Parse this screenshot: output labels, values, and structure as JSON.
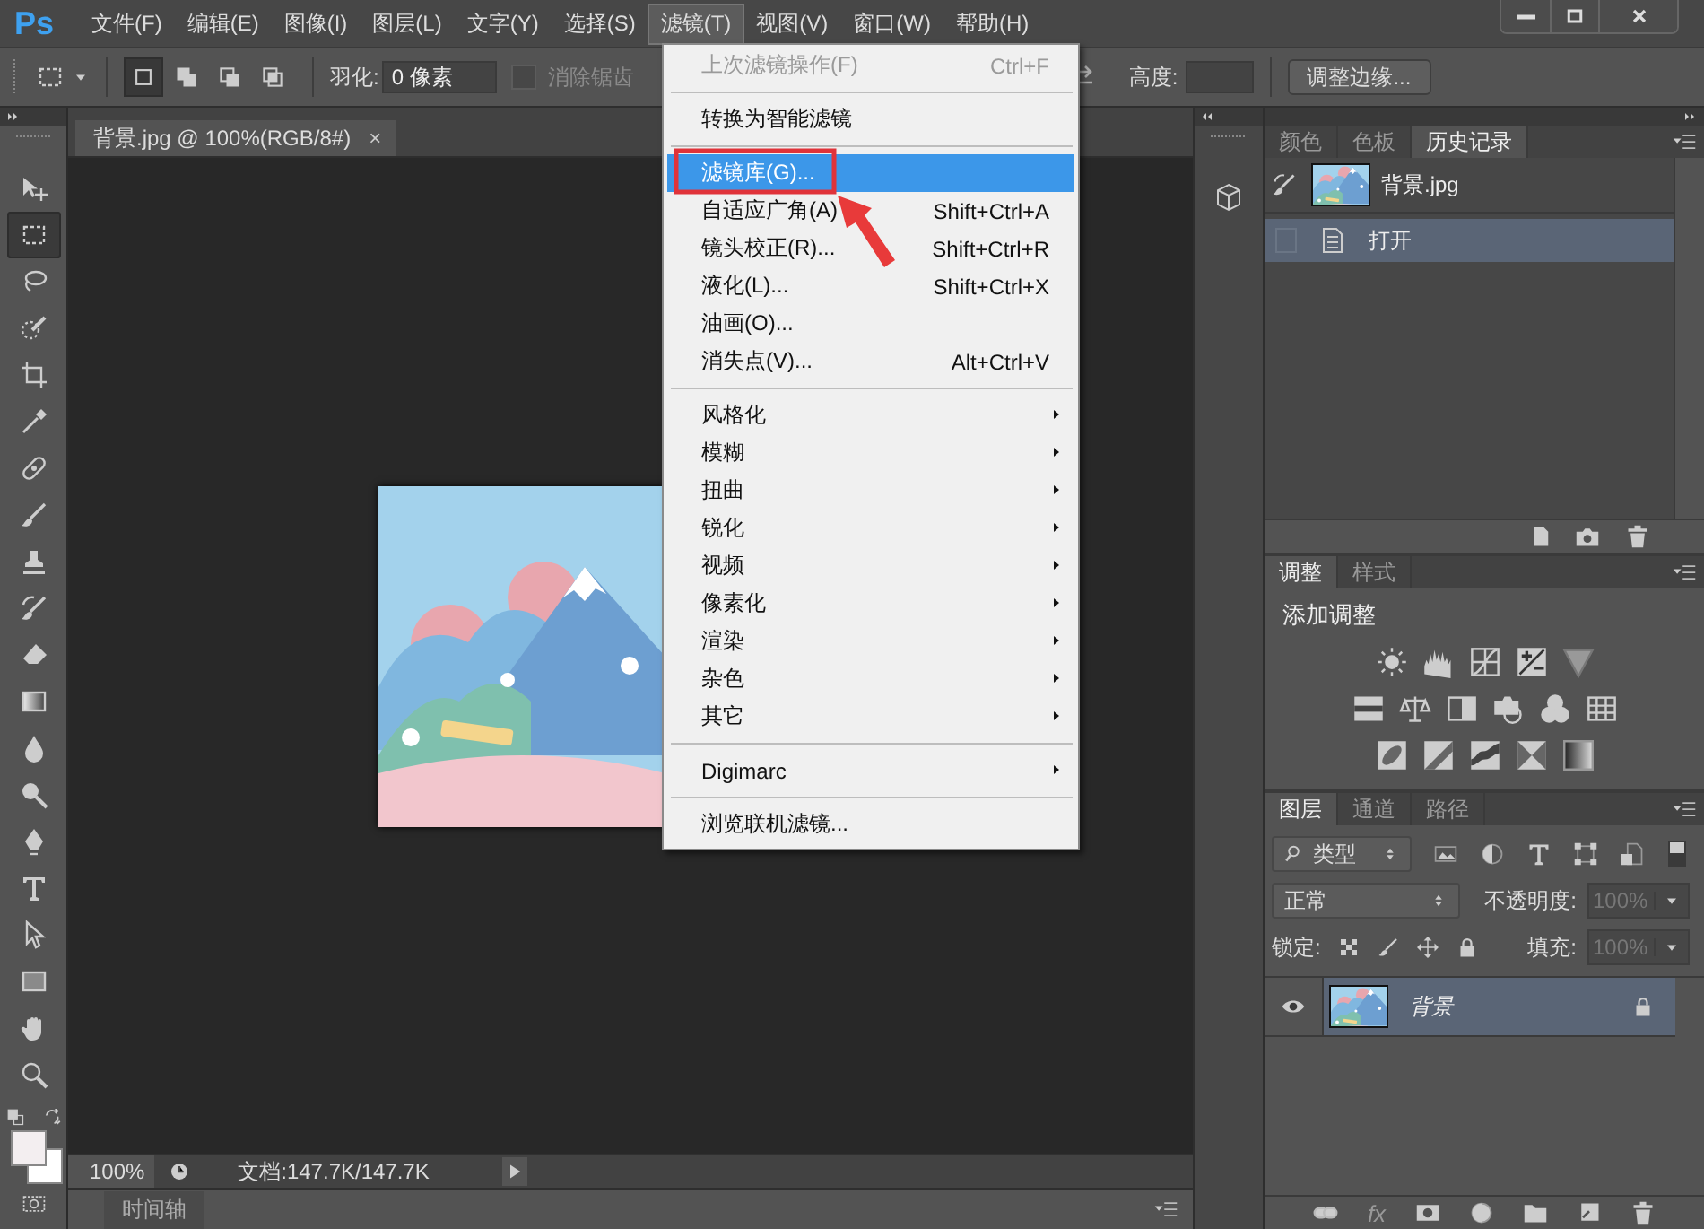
{
  "menu_bar": {
    "logo": "Ps",
    "menus": [
      {
        "label": "文件(F)",
        "selected": false
      },
      {
        "label": "编辑(E)",
        "selected": false
      },
      {
        "label": "图像(I)",
        "selected": false
      },
      {
        "label": "图层(L)",
        "selected": false
      },
      {
        "label": "文字(Y)",
        "selected": false
      },
      {
        "label": "选择(S)",
        "selected": false
      },
      {
        "label": "滤镜(T)",
        "selected": true
      },
      {
        "label": "视图(V)",
        "selected": false
      },
      {
        "label": "窗口(W)",
        "selected": false
      },
      {
        "label": "帮助(H)",
        "selected": false
      }
    ]
  },
  "options_bar": {
    "modes": [
      {
        "selected": true
      },
      {
        "selected": false
      },
      {
        "selected": false
      },
      {
        "selected": false
      }
    ],
    "feather_label": "羽化:",
    "feather_value": "0 像素",
    "antialias": {
      "label": "消除锯齿",
      "checked": false,
      "disabled": true
    },
    "height_label": "高度:",
    "refine_edge_button": "调整边缘..."
  },
  "tools": [
    {
      "selected": false
    },
    {
      "selected": true
    },
    {
      "selected": false
    },
    {
      "selected": false
    },
    {
      "selected": false
    },
    {
      "selected": false
    },
    {
      "selected": false
    },
    {
      "selected": false
    },
    {
      "selected": false
    },
    {
      "selected": false
    },
    {
      "selected": false
    },
    {
      "selected": false
    },
    {
      "selected": false
    },
    {
      "selected": false
    },
    {
      "selected": false
    },
    {
      "selected": false
    },
    {
      "selected": false
    },
    {
      "selected": false
    },
    {
      "selected": false
    },
    {
      "selected": false
    }
  ],
  "document_tab": {
    "title": "背景.jpg @ 100%(RGB/8#)",
    "close": "×"
  },
  "status_bar": {
    "zoom": "100%",
    "doc_info": "文档:147.7K/147.7K"
  },
  "timeline_bar": {
    "label": "时间轴"
  },
  "filter_menu": {
    "sections": [
      {
        "items": [
          {
            "label": "上次滤镜操作(F)",
            "shortcut": "Ctrl+F",
            "disabled": true,
            "selected": false,
            "submenu": false
          }
        ]
      },
      {
        "items": [
          {
            "label": "转换为智能滤镜",
            "disabled": false,
            "selected": false,
            "submenu": false
          }
        ]
      },
      {
        "items": [
          {
            "label": "滤镜库(G)...",
            "disabled": false,
            "selected": true,
            "submenu": false
          },
          {
            "label": "自适应广角(A)",
            "shortcut": "Shift+Ctrl+A",
            "disabled": false,
            "selected": false,
            "submenu": false
          },
          {
            "label": "镜头校正(R)...",
            "shortcut": "Shift+Ctrl+R",
            "disabled": false,
            "selected": false,
            "submenu": false
          },
          {
            "label": "液化(L)...",
            "shortcut": "Shift+Ctrl+X",
            "disabled": false,
            "selected": false,
            "submenu": false
          },
          {
            "label": "油画(O)...",
            "disabled": false,
            "selected": false,
            "submenu": false
          },
          {
            "label": "消失点(V)...",
            "shortcut": "Alt+Ctrl+V",
            "disabled": false,
            "selected": false,
            "submenu": false
          }
        ]
      },
      {
        "items": [
          {
            "label": "风格化",
            "disabled": false,
            "selected": false,
            "submenu": true
          },
          {
            "label": "模糊",
            "disabled": false,
            "selected": false,
            "submenu": true
          },
          {
            "label": "扭曲",
            "disabled": false,
            "selected": false,
            "submenu": true
          },
          {
            "label": "锐化",
            "disabled": false,
            "selected": false,
            "submenu": true
          },
          {
            "label": "视频",
            "disabled": false,
            "selected": false,
            "submenu": true
          },
          {
            "label": "像素化",
            "disabled": false,
            "selected": false,
            "submenu": true
          },
          {
            "label": "渲染",
            "disabled": false,
            "selected": false,
            "submenu": true
          },
          {
            "label": "杂色",
            "disabled": false,
            "selected": false,
            "submenu": true
          },
          {
            "label": "其它",
            "disabled": false,
            "selected": false,
            "submenu": true
          }
        ]
      },
      {
        "items": [
          {
            "label": "Digimarc",
            "disabled": false,
            "selected": false,
            "submenu": true
          }
        ]
      },
      {
        "items": [
          {
            "label": "浏览联机滤镜...",
            "disabled": false,
            "selected": false,
            "submenu": false
          }
        ]
      }
    ]
  },
  "history_panel": {
    "tabs": [
      {
        "label": "颜色",
        "selected": false
      },
      {
        "label": "色板",
        "selected": false
      },
      {
        "label": "历史记录",
        "selected": true
      }
    ],
    "snapshot": {
      "label": "背景.jpg"
    },
    "states": [
      {
        "label": "打开",
        "selected": true
      }
    ]
  },
  "adjustments_panel": {
    "tabs": [
      {
        "label": "调整",
        "selected": true
      },
      {
        "label": "样式",
        "selected": false
      }
    ],
    "title": "添加调整"
  },
  "layers_panel": {
    "tabs": [
      {
        "label": "图层",
        "selected": true
      },
      {
        "label": "通道",
        "selected": false
      },
      {
        "label": "路径",
        "selected": false
      }
    ],
    "filter_kind": "类型",
    "filter_on": true,
    "blend_mode": "正常",
    "opacity_label": "不透明度:",
    "opacity": "100%",
    "lock_label": "锁定:",
    "fill_label": "填充:",
    "fill": "100%",
    "fields_disabled": true,
    "fx_button": "fx",
    "layers": [
      {
        "name": "背景",
        "visible": true,
        "locked": true,
        "selected": true
      }
    ]
  }
}
